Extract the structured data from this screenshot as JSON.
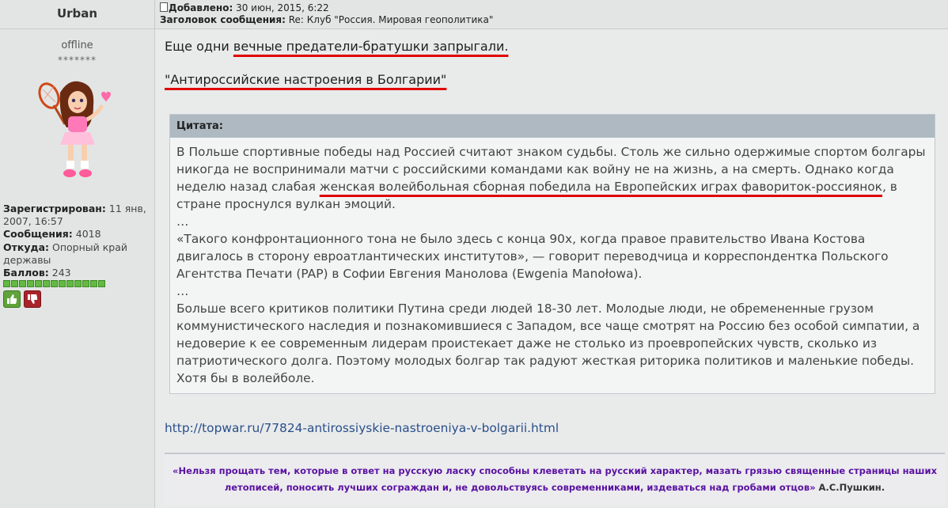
{
  "user": {
    "name": "Urban",
    "status": "offline",
    "stars": "*******",
    "registered_label": "Зарегистрирован:",
    "registered_value": " 11 янв, 2007, 16:57",
    "messages_label": "Сообщения:",
    "messages_value": " 4018",
    "from_label": "Откуда:",
    "from_value": " Опорный край державы",
    "points_label": "Баллов:",
    "points_value": " 243",
    "rating_pips": 13
  },
  "post": {
    "added_label": "Добавлено:",
    "added_value": " 30 июн, 2015, 6:22",
    "subject_label": "Заголовок сообщения:",
    "subject_value": " Re: Клуб \"Россия. Мировая геополитика\"",
    "line1_prefix": "Еще одни ",
    "line1_highlight": "вечные предатели-братушки запрыгали.",
    "line2": "\"Антироссийские настроения в Болгарии\"",
    "quote_title": "Цитата:",
    "quote_p1_a": "В Польше спортивные победы над Россией считают знаком судьбы. Столь же сильно одержимые спортом болгары никогда не воспринимали матчи с российскими командами как войну не на жизнь, а на смерть. Однако когда неделю назад слабая ",
    "quote_p1_highlight": "женская волейбольная сборная победила на Европейских играх фавориток-россиянок",
    "quote_p1_b": ", в стране проснулся вулкан эмоций.",
    "ellipsis1": "…",
    "quote_p2": "«Такого конфронтационного тона не было здесь с конца 90х, когда правое правительство Ивана Костова двигалось в сторону евроатлантических институтов», — говорит переводчица и корреспондентка Польского Агентства Печати (PAP) в Софии Евгения Манолова (Ewgenia Manołowa).",
    "ellipsis2": "…",
    "quote_p3": "Больше всего критиков политики Путина среди людей 18-30 лет. Молодые люди, не обремененные грузом коммунистического наследия и познакомившиеся с Западом, все чаще смотрят на Россию без особой симпатии, а недоверие к ее современным лидерам проистекает даже не столько из проевропейских чувств, сколько из патриотического долга. Поэтому молодых болгар так радуют жесткая риторика политиков и маленькие победы. Хотя бы в волейболе.",
    "link": "http://topwar.ru/77824-antirossiyskie-nastroeniya-v-bolgarii.html"
  },
  "signature": {
    "text": "«Нельзя прощать тем, которые в ответ на русскую ласку способны клеветать на русский характер, мазать грязью священные страницы наших летописей, поносить лучших сограждан и, не довольствуясь современниками, издеваться над гробами отцов»",
    "author": " А.С.Пушкин."
  },
  "colors": {
    "highlight_underline": "#e00000",
    "quote_header": "#aeb9c1",
    "signature_text": "#5a12a0",
    "link": "#2a4f8a"
  }
}
